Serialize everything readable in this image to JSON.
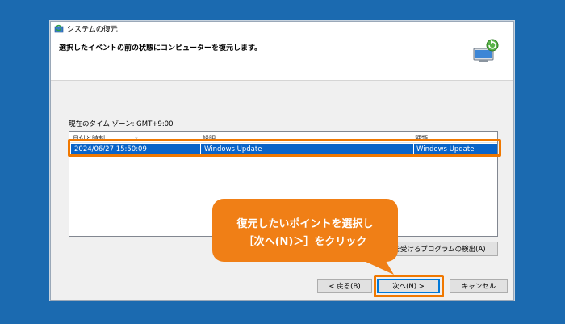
{
  "window": {
    "title": "システムの復元",
    "subtitle": "選択したイベントの前の状態にコンピューターを復元します。"
  },
  "timezone_label": "現在のタイム ゾーン: GMT+9:00",
  "restore_list": {
    "columns": [
      "日付と時刻",
      "説明",
      "種類"
    ],
    "rows": [
      {
        "datetime": "2024/06/27 15:50:09",
        "description": "Windows Update",
        "type": "Windows Update",
        "selected": true
      }
    ]
  },
  "buttons": {
    "scan": "影響を受けるプログラムの検出(A)",
    "back": "< 戻る(B)",
    "next": "次へ(N) >",
    "cancel": "キャンセル"
  },
  "callout": {
    "line1": "復元したいポイントを選択し",
    "line2": "［次へ(N)＞］をクリック"
  },
  "colors": {
    "background": "#1b6ab0",
    "selection": "#0a64c8",
    "highlight": "#f07800",
    "callout": "#f07f16"
  },
  "icons": {
    "title": "system-restore-icon",
    "header": "computer-restore-icon"
  }
}
